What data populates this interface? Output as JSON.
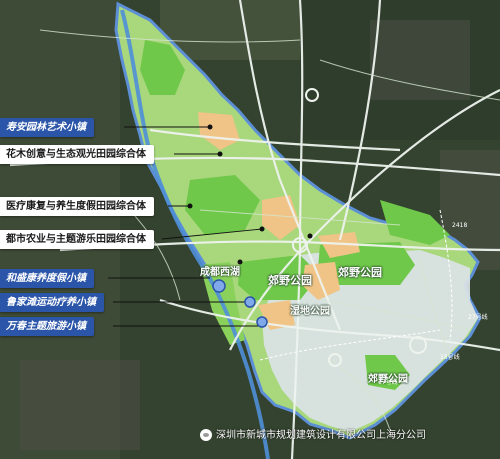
{
  "labels": {
    "shouan": "寿安园林艺术小镇",
    "huamu": "花木创意与生态观光田园综合体",
    "yiliao": "医疗康复与养生度假田园综合体",
    "dushi": "都市农业与主题游乐田园综合体",
    "hesheng": "和盛康养度假小镇",
    "lujiatan": "鲁家滩运动疗养小镇",
    "wanchun": "万春主题旅游小镇"
  },
  "map_text": {
    "chengdu_xihu": "成都西湖",
    "jiaoye_1": "郊野公园",
    "jiaoye_2": "郊野公园",
    "shidi": "湿地公园",
    "jiaoye_3": "郊野公园"
  },
  "map_marks": {
    "m1": "2418",
    "m2": "27号线",
    "m3": "18号线",
    "m4": "17号线"
  },
  "watermark": "深圳市新城市规划建筑设计有限公司上海分公司",
  "colors": {
    "town_label_bg": "#2a55a8",
    "complex_label_bg": "#ffffff",
    "boundary": "#5c8fd6",
    "park_green": "#6fc84a",
    "light_green": "#b7e089",
    "orange": "#f0c487"
  }
}
